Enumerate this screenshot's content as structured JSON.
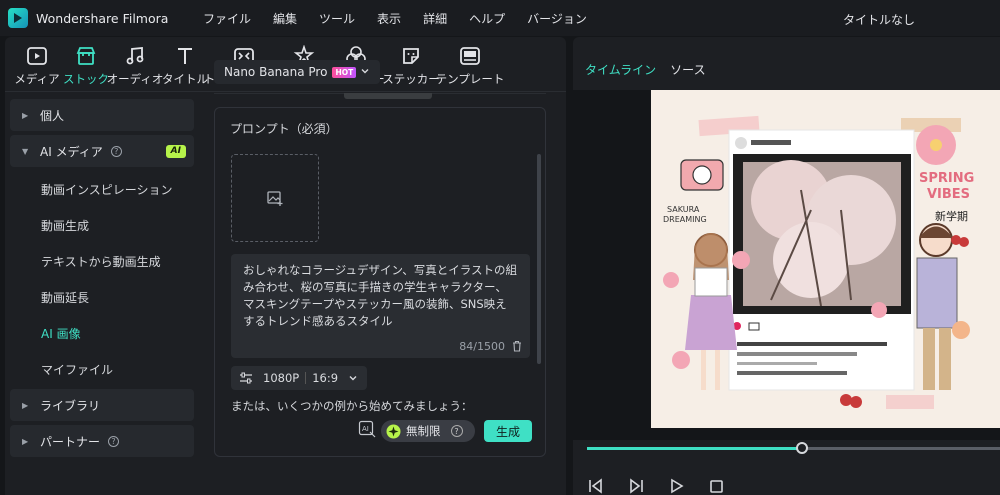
{
  "app": {
    "name": "Wondershare Filmora",
    "window_title": "タイトルなし"
  },
  "menu": [
    "ファイル",
    "編集",
    "ツール",
    "表示",
    "詳細",
    "ヘルプ",
    "バージョン"
  ],
  "toolbar": [
    {
      "label": "メディア",
      "icon": "media-icon"
    },
    {
      "label": "ストック",
      "icon": "stock-icon",
      "active": true
    },
    {
      "label": "オーディオ",
      "icon": "music-note-icon"
    },
    {
      "label": "タイトル",
      "icon": "title-t-icon"
    },
    {
      "label": "トランジション",
      "icon": "transition-icon"
    },
    {
      "label": "エフェクト",
      "icon": "effect-star-icon"
    },
    {
      "label": "フィルター",
      "icon": "filter-icon"
    },
    {
      "label": "ステッカー",
      "icon": "sticker-icon"
    },
    {
      "label": "テンプレート",
      "icon": "template-icon"
    }
  ],
  "sidebar": {
    "personal": "個人",
    "ai_media": "AI メディア",
    "ai_badge": "AI",
    "ai_items": [
      "動画インスピレーション",
      "動画生成",
      "テキストから動画生成",
      "動画延長",
      "AI 画像",
      "マイファイル"
    ],
    "active_index": 4,
    "library": "ライブラリ",
    "partner": "パートナー"
  },
  "model": {
    "name": "Nano Banana Pro",
    "badge": "HOT"
  },
  "prompt": {
    "title": "プロンプト（必須）",
    "text": "おしゃれなコラージュデザイン、写真とイラストの組み合わせ、桜の写真に手描きの学生キャラクター、マスキングテープやステッカー風の装飾、SNS映えするトレンド感あるスタイル",
    "counter": "84/1500",
    "resolution": "1080P",
    "aspect": "16:9",
    "examples_hint": "または、いくつかの例から始めてみましょう：",
    "unlimited": "無制限",
    "generate": "生成"
  },
  "preview": {
    "tabs": [
      "タイムライン",
      "ソース"
    ],
    "active_tab": 0,
    "progress": 0.52
  },
  "colors": {
    "accent": "#3fe0c5",
    "ai_badge": "#b6f34a"
  }
}
